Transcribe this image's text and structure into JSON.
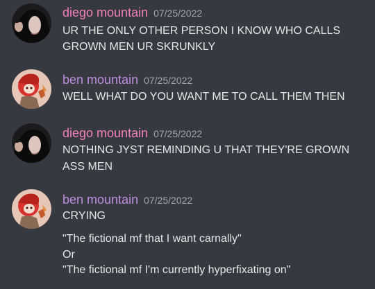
{
  "colors": {
    "background": "#36393f",
    "username_diego": "#f47fbd",
    "username_ben": "#c08ee0",
    "timestamp": "#a3a6aa",
    "message_text": "#e6e7e8"
  },
  "messages": [
    {
      "author": "diego mountain",
      "timestamp": "07/25/2022",
      "avatar_icon": "diego-avatar",
      "lines": [
        "UR THE ONLY OTHER PERSON I KNOW WHO CALLS",
        "GROWN MEN UR SKRUNKLY"
      ]
    },
    {
      "author": "ben mountain",
      "timestamp": "07/25/2022",
      "avatar_icon": "ben-avatar",
      "lines": [
        "WELL WHAT DO YOU WANT ME TO CALL THEM THEN"
      ]
    },
    {
      "author": "diego mountain",
      "timestamp": "07/25/2022",
      "avatar_icon": "diego-avatar",
      "lines": [
        "NOTHING JYST REMINDING U THAT THEY'RE GROWN",
        "ASS MEN"
      ]
    },
    {
      "author": "ben mountain",
      "timestamp": "07/25/2022",
      "avatar_icon": "ben-avatar",
      "lines": [
        "CRYING"
      ],
      "followup_lines": [
        "\"The fictional mf that I want carnally\"",
        "Or",
        "\"The fictional mf I'm currently hyperfixating on\""
      ]
    }
  ]
}
